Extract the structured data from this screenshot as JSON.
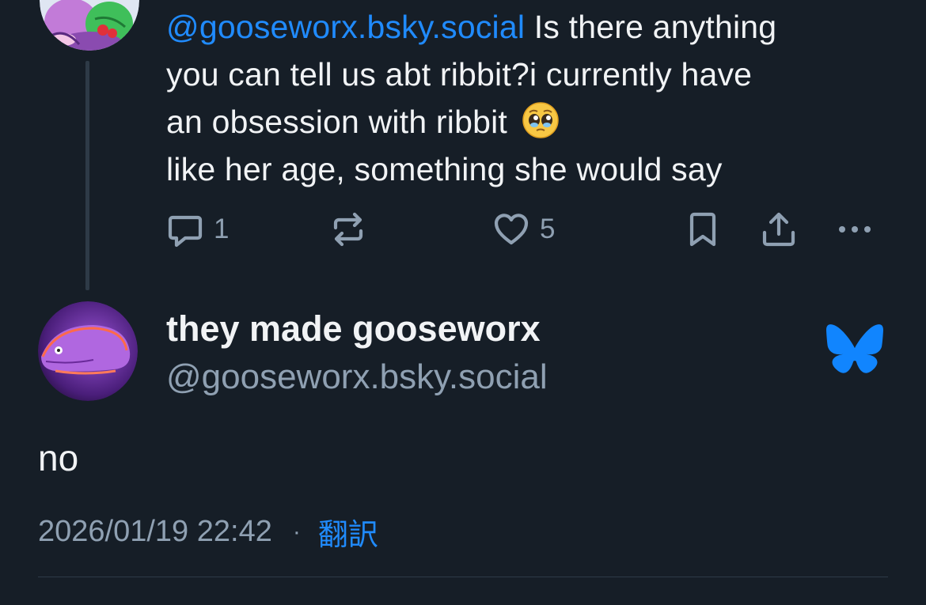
{
  "parent_post": {
    "text_mention": "@gooseworx.bsky.social",
    "text_line1_rest": " Is there anything",
    "text_line2": "you can tell us abt ribbit?i currently have",
    "text_line3": "an obsession with ribbit",
    "text_line4": "like her age, something she would say",
    "emoji_icon": "pleading-face-icon",
    "actions": {
      "reply_count": "1",
      "repost_count": "",
      "like_count": "5"
    }
  },
  "post": {
    "display_name": "they made gooseworx",
    "handle": "@gooseworx.bsky.social",
    "text": "no",
    "timestamp": "2026/01/19 22:42",
    "separator": "·",
    "translate_label": "翻訳"
  },
  "colors": {
    "background": "#161e27",
    "text_primary": "#f1f3f5",
    "text_secondary": "#8fa0b2",
    "accent_blue": "#208bfe",
    "thread_line": "#2e3a47"
  }
}
